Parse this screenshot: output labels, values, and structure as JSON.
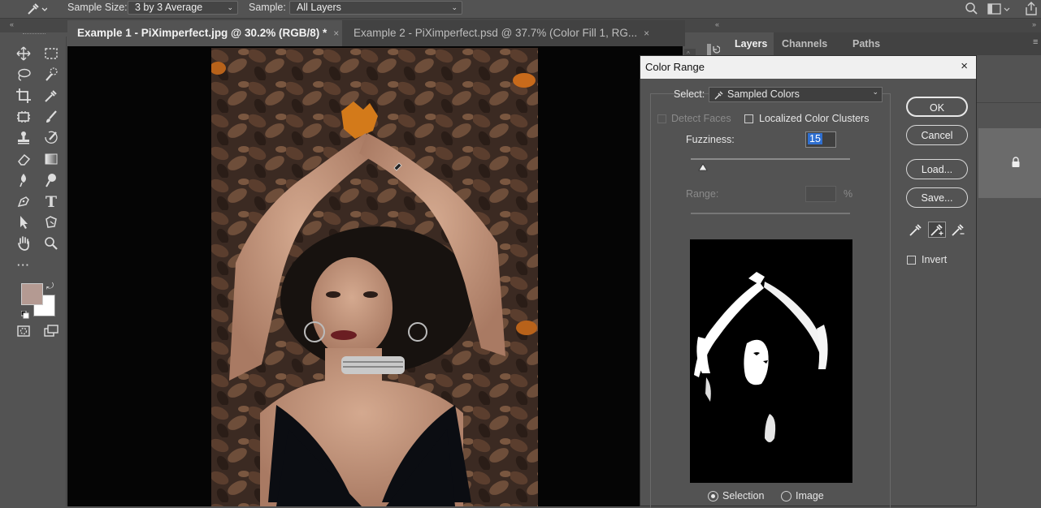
{
  "options_bar": {
    "sample_size_label": "Sample Size:",
    "sample_size_value": "3 by 3 Average",
    "sample_label": "Sample:",
    "sample_value": "All Layers"
  },
  "document_tabs": [
    {
      "label": "Example 1 - PiXimperfect.jpg @ 30.2% (RGB/8) *",
      "close": "×"
    },
    {
      "label": "Example 2 - PiXimperfect.psd @ 37.7% (Color Fill 1, RG...",
      "close": "×"
    }
  ],
  "panel_tabs": [
    "Layers",
    "Channels",
    "Paths"
  ],
  "dialog": {
    "title": "Color Range",
    "close": "×",
    "select_label": "Select:",
    "select_value": "Sampled Colors",
    "detect_faces": "Detect Faces",
    "localized_clusters": "Localized Color Clusters",
    "fuzziness_label": "Fuzziness:",
    "fuzziness_value": "15",
    "range_label": "Range:",
    "range_unit": "%",
    "buttons": {
      "ok": "OK",
      "cancel": "Cancel",
      "load": "Load...",
      "save": "Save..."
    },
    "invert_label": "Invert",
    "view_selection": "Selection",
    "view_image": "Image"
  },
  "colors": {
    "foreground": "#b49a92",
    "background": "#ffffff",
    "ui_bg": "#535353",
    "canvas_bg": "#050505"
  },
  "icons": [
    "eyedropper-icon",
    "search-icon",
    "workspace-icon",
    "share-icon",
    "move-icon",
    "marquee-icon",
    "lasso-icon",
    "quick-select-icon",
    "crop-icon",
    "frame-icon",
    "eyedropper-tool-icon",
    "healing-icon",
    "brush-icon",
    "stamp-icon",
    "history-brush-icon",
    "eraser-icon",
    "gradient-icon",
    "blur-icon",
    "dodge-icon",
    "pen-icon",
    "type-icon",
    "path-select-icon",
    "shape-icon",
    "hand-icon",
    "zoom-icon",
    "more-icon",
    "lock-icon"
  ]
}
